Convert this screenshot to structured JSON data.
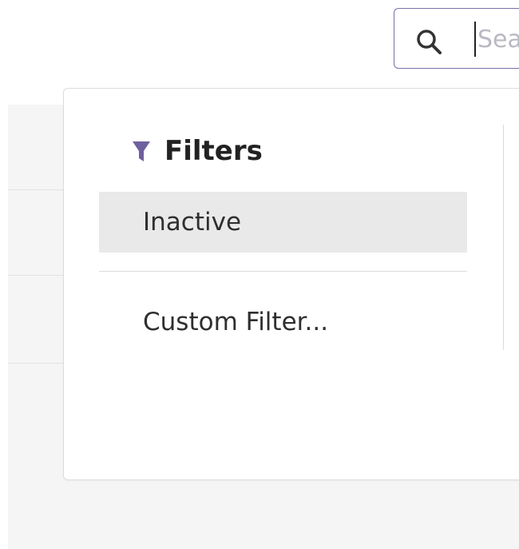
{
  "search": {
    "placeholder": "Search...",
    "value": ""
  },
  "filters_menu": {
    "title": "Filters",
    "items": [
      {
        "label": "Inactive",
        "selected": true
      },
      {
        "label": "Custom Filter...",
        "selected": false
      }
    ]
  },
  "icons": {
    "search": "search-icon",
    "filter": "funnel-icon"
  },
  "colors": {
    "accent": "#7c6fa8",
    "funnel": "#6f5f9e",
    "selected_bg": "#e9e9e9",
    "page_bg": "#f5f5f5"
  }
}
